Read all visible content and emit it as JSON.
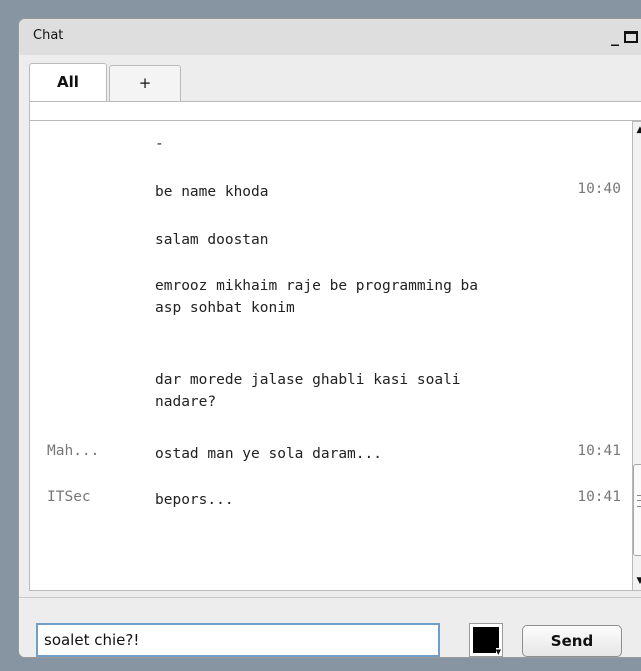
{
  "window": {
    "title": "Chat",
    "min_glyph": "_",
    "max_icon": "maximize-icon"
  },
  "tabs": [
    {
      "label": "All"
    },
    {
      "label": "+"
    }
  ],
  "messages": [
    {
      "user": "",
      "text": "-",
      "time": ""
    },
    {
      "user": "",
      "text": "be name khoda",
      "time": "10:40"
    },
    {
      "user": "",
      "text": "salam doostan",
      "time": ""
    },
    {
      "user": "",
      "text": "emrooz mikhaim raje be programming ba asp sohbat konim",
      "time": ""
    },
    {
      "user": "",
      "text": "dar morede jalase ghabli kasi soali nadare?",
      "time": ""
    },
    {
      "user": "Mah...",
      "text": "ostad man ye sola daram...",
      "time": "10:41"
    },
    {
      "user": "ITSec",
      "text": "bepors...",
      "time": "10:41"
    }
  ],
  "composer": {
    "input_value": "soalet chie?!",
    "color_value": "#000000",
    "send_label": "Send"
  },
  "colors": {
    "background": "#8795a2",
    "panel": "#ededed",
    "input_border": "#6f9fc6"
  }
}
